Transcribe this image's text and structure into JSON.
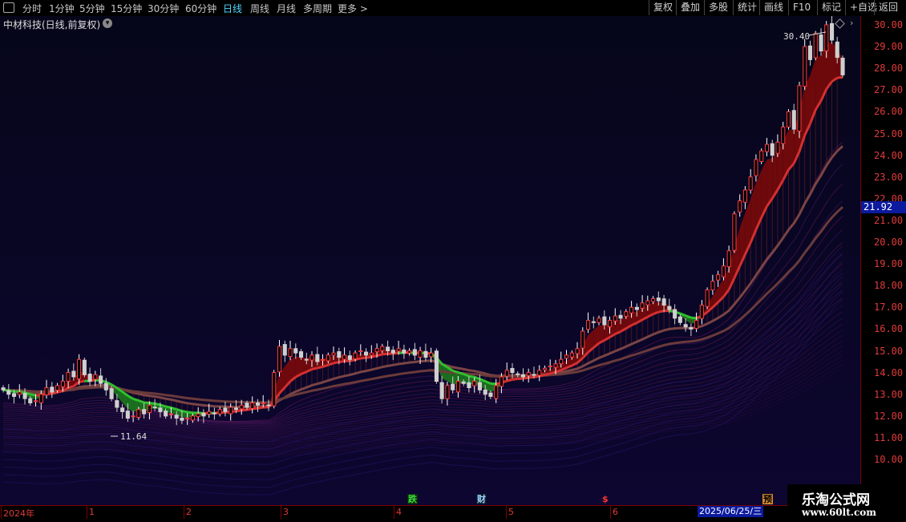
{
  "toolbar": {
    "periods": [
      "分时",
      "1分钟",
      "5分钟",
      "15分钟",
      "30分钟",
      "60分钟",
      "日线",
      "周线",
      "月线",
      "多周期",
      "更多 >"
    ],
    "active_period": "日线",
    "right_buttons": [
      "复权",
      "叠加",
      "多股",
      "统计",
      "画线",
      "F10",
      "标记",
      "+自选",
      "返回"
    ]
  },
  "header": {
    "title": "中材科技(日线,前复权)"
  },
  "price_axis": {
    "ticks": [
      "30.00",
      "29.00",
      "28.00",
      "27.00",
      "26.00",
      "25.00",
      "24.00",
      "23.00",
      "22.00",
      "21.00",
      "20.00",
      "19.00",
      "18.00",
      "17.00",
      "16.00",
      "15.00",
      "14.00",
      "13.00",
      "12.00",
      "11.00",
      "10.00"
    ],
    "current_price": "21.92"
  },
  "annotations": {
    "high": "30.40",
    "low": "11.64"
  },
  "time_axis": {
    "labels": [
      "2024年",
      "1",
      "2",
      "3",
      "4",
      "5",
      "6"
    ],
    "cursor_date": "2025/06/25/三"
  },
  "events": {
    "die": "跌",
    "cai": "财",
    "s": "$",
    "yu": "预"
  },
  "watermark": {
    "line1": "乐淘公式网",
    "line2": "www.60lt.com"
  },
  "chart_data": {
    "type": "candlestick",
    "title": "中材科技(日线,前复权)",
    "ylim": [
      9.5,
      30.9
    ],
    "x_segments": [
      "2024年",
      "1",
      "2",
      "3",
      "4",
      "5",
      "6"
    ],
    "max_marked": 30.4,
    "min_marked": 11.64,
    "last_price": 21.92,
    "closes": [
      13.2,
      13.0,
      12.9,
      13.1,
      12.8,
      12.6,
      12.7,
      13.0,
      13.3,
      13.1,
      13.4,
      13.6,
      14.0,
      13.8,
      14.6,
      13.9,
      13.6,
      13.9,
      13.5,
      13.2,
      12.8,
      12.4,
      12.2,
      11.9,
      12.0,
      12.3,
      12.1,
      12.5,
      12.4,
      12.2,
      12.0,
      12.1,
      11.9,
      11.8,
      11.9,
      12.0,
      12.1,
      12.0,
      12.2,
      12.1,
      12.3,
      12.2,
      12.4,
      12.3,
      12.5,
      12.4,
      12.6,
      12.5,
      12.6,
      12.5,
      14.0,
      15.2,
      14.8,
      15.1,
      14.9,
      14.7,
      14.6,
      14.8,
      14.5,
      14.6,
      14.8,
      14.9,
      14.7,
      14.8,
      14.6,
      14.9,
      15.0,
      14.8,
      14.9,
      15.1,
      15.2,
      15.0,
      14.9,
      15.1,
      14.9,
      15.0,
      14.8,
      15.0,
      14.7,
      14.9,
      13.6,
      12.8,
      13.4,
      13.2,
      13.6,
      13.5,
      13.3,
      13.6,
      13.2,
      13.0,
      12.9,
      13.4,
      13.8,
      14.1,
      14.0,
      13.9,
      13.8,
      14.0,
      13.9,
      14.1,
      14.2,
      14.3,
      14.4,
      14.6,
      14.8,
      14.9,
      15.1,
      15.9,
      16.4,
      16.3,
      16.5,
      16.2,
      16.4,
      16.6,
      16.5,
      16.8,
      17.0,
      16.9,
      17.2,
      17.3,
      17.4,
      17.3,
      17.1,
      16.9,
      16.5,
      16.3,
      16.1,
      16.0,
      16.4,
      17.1,
      17.8,
      18.2,
      18.5,
      18.9,
      19.6,
      21.3,
      21.9,
      22.4,
      23.0,
      23.8,
      24.2,
      24.5,
      24.0,
      24.6,
      25.3,
      26.0,
      25.2,
      27.2,
      29.0,
      28.4,
      29.6,
      28.8,
      30.0,
      29.3,
      28.5,
      27.7
    ]
  }
}
